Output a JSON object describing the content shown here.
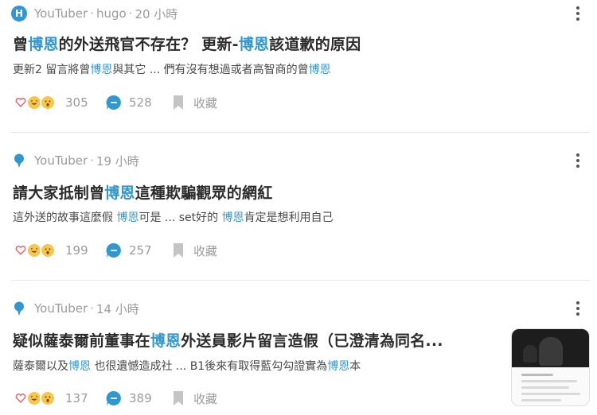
{
  "colors": {
    "accent": "#3397cf",
    "meta": "#9b9b9b",
    "heart": "#e8606b",
    "emoji": "#f7c64a"
  },
  "icons": {
    "more": "more-vertical-icon",
    "comment": "comment-bubble-icon",
    "save": "bookmark-icon",
    "pin_avatar": "pin-icon"
  },
  "posts": [
    {
      "avatar_letter": "H",
      "forum": "YouTuber",
      "author": "hugo",
      "time": "20 小時",
      "title_parts": [
        "曾",
        "博恩",
        "的外送飛官不存在？ 更新-",
        "博恩",
        "該道歉的原因"
      ],
      "excerpt_parts": [
        "更新2 留言將曾",
        "博恩",
        "與其它 ... 們有沒有想過或者高智商的曾",
        "博恩",
        ""
      ],
      "reactions": "305",
      "comments": "528",
      "save_label": "收藏"
    },
    {
      "forum": "YouTuber",
      "time": "19 小時",
      "title_parts": [
        "請大家抵制曾",
        "博恩",
        "這種欺騙觀眾的網紅",
        "",
        ""
      ],
      "excerpt_parts": [
        "這外送的故事這麼假 ",
        "博恩",
        "可是 ... set好的 ",
        "博恩",
        "肯定是想利用自己"
      ],
      "reactions": "199",
      "comments": "257",
      "save_label": "收藏"
    },
    {
      "forum": "YouTuber",
      "time": "14 小時",
      "title_parts": [
        "疑似薩泰爾前董事在",
        "博恩",
        "外送員影片留言造假（已澄清為同名...",
        "",
        ""
      ],
      "excerpt_parts": [
        "薩泰爾以及",
        "博恩",
        " 也很遺憾造成社 ... B1後來有取得藍勾勾證實為",
        "博恩",
        "本"
      ],
      "reactions": "137",
      "comments": "389",
      "save_label": "收藏"
    }
  ],
  "separator": "·"
}
